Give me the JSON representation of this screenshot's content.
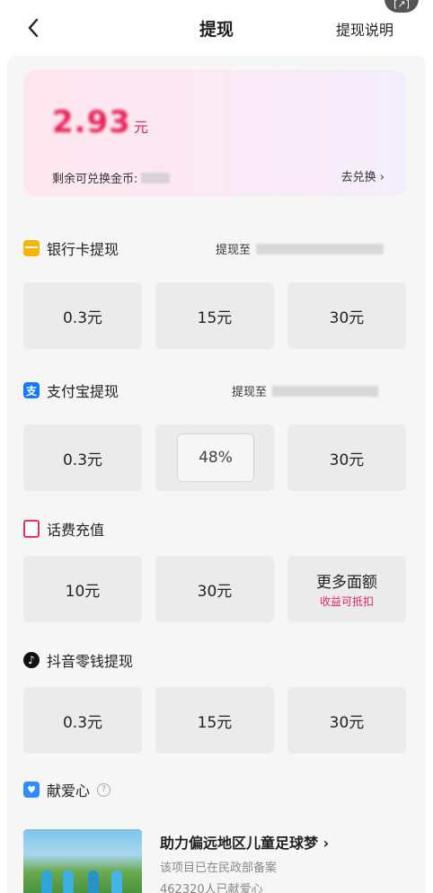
{
  "header": {
    "back_icon": "chevron-left-icon",
    "title": "提现",
    "explain_label": "提现说明",
    "corner_badge": "[↗]"
  },
  "balance": {
    "amount": "2.93",
    "unit": "元",
    "coins_label": "剩余可兑换金币:",
    "exchange_label": "去兑换 ›"
  },
  "bank": {
    "title": "银行卡提现",
    "target_label": "提现至",
    "options": [
      "0.3元",
      "15元",
      "30元"
    ]
  },
  "alipay": {
    "title": "支付宝提现",
    "target_label": "提现至",
    "options": [
      "0.3元",
      "48%",
      "30元"
    ],
    "tooltip": "48%"
  },
  "phone": {
    "title": "话费充值",
    "options": [
      "10元",
      "30元",
      "更多面额"
    ],
    "more_sub": "收益可抵扣"
  },
  "douyin": {
    "title": "抖音零钱提现",
    "options": [
      "0.3元",
      "15元",
      "30元"
    ]
  },
  "love": {
    "title": "献爱心",
    "help_icon": "question-circle-icon",
    "project_title": "助力偏远地区儿童足球梦 ›",
    "project_sub": "该项目已在民政部备案",
    "project_count": "462320人已献爱心"
  },
  "colors": {
    "accent": "#e8235a",
    "bank_icon": "#f7b500",
    "alipay_icon": "#1677ff",
    "phone_icon": "#ee2d5b",
    "love_icon": "#2f8cff"
  }
}
